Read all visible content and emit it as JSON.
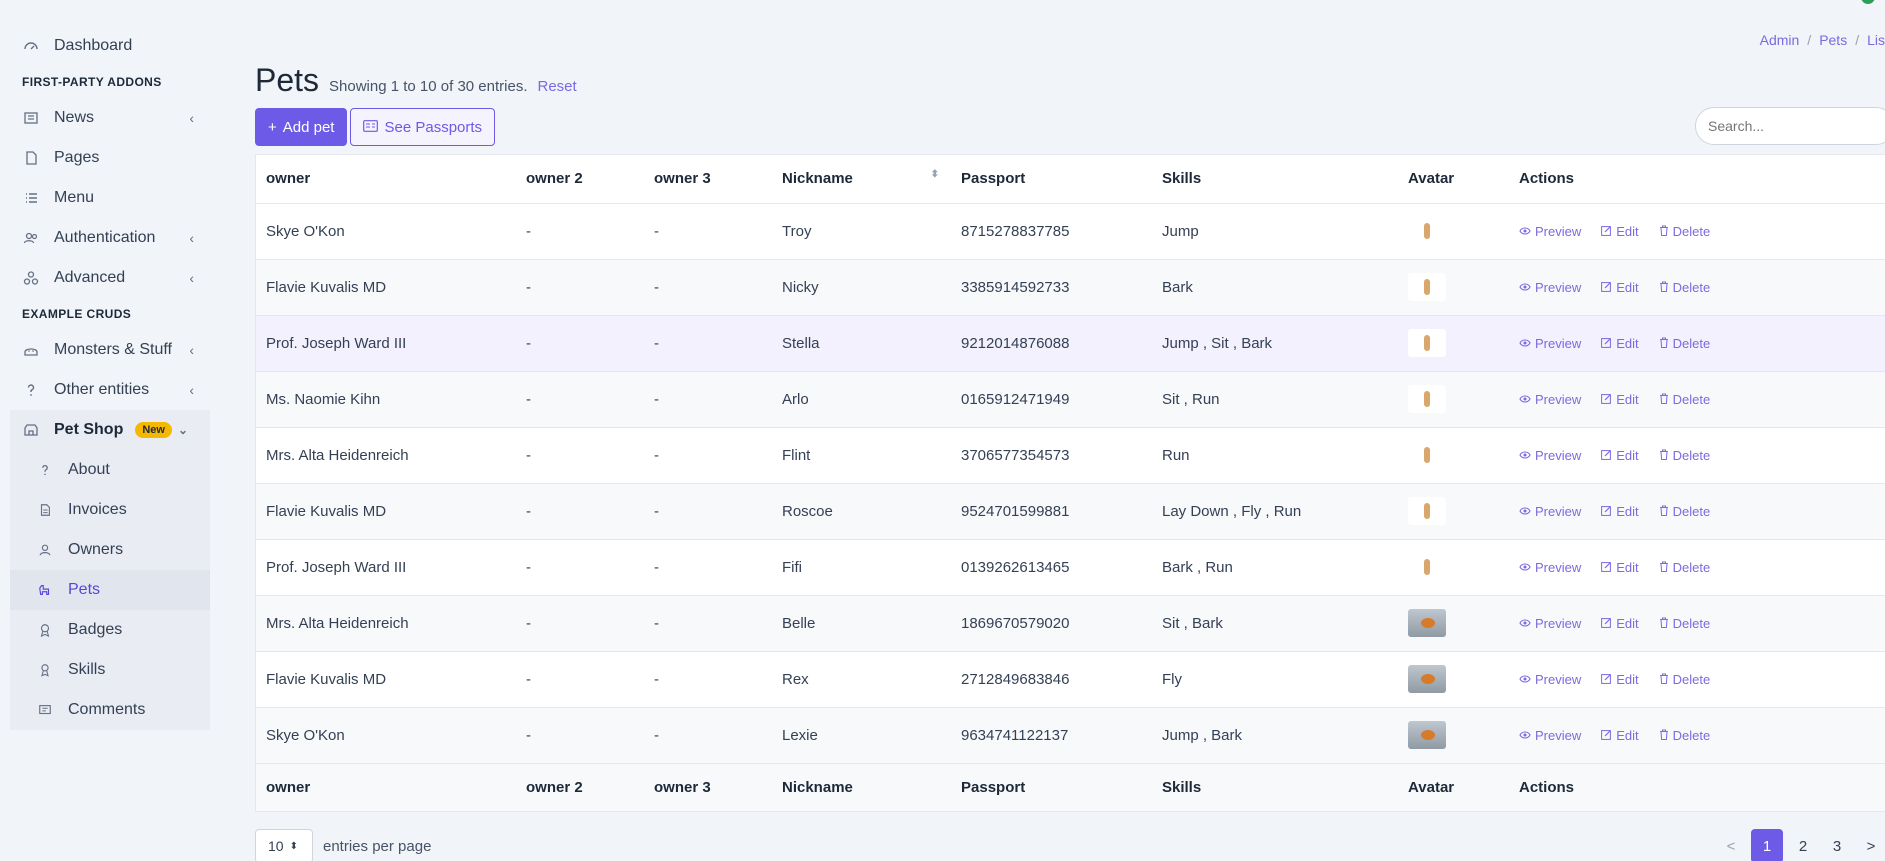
{
  "sidebar": {
    "dashboard": "Dashboard",
    "heading_addons": "FIRST-PARTY ADDONS",
    "news": "News",
    "pages": "Pages",
    "menu": "Menu",
    "authentication": "Authentication",
    "advanced": "Advanced",
    "heading_cruds": "EXAMPLE CRUDS",
    "monsters": "Monsters & Stuff",
    "other_entities": "Other entities",
    "pet_shop": "Pet Shop",
    "pet_shop_badge": "New",
    "sub_items": [
      "About",
      "Invoices",
      "Owners",
      "Pets",
      "Badges",
      "Skills",
      "Comments"
    ],
    "chevron": "‹"
  },
  "breadcrumb": [
    "Admin",
    "Pets",
    "Lis"
  ],
  "header": {
    "title": "Pets",
    "subtitle": "Showing 1 to 10 of 30 entries.",
    "reset": "Reset"
  },
  "buttons": {
    "add": "Add pet",
    "passports": "See Passports"
  },
  "search": {
    "placeholder": "Search..."
  },
  "table": {
    "columns": [
      "owner",
      "owner 2",
      "owner 3",
      "Nickname",
      "Passport",
      "Skills",
      "Avatar",
      "Actions"
    ],
    "rows": [
      {
        "owner": "Skye O'Kon",
        "owner2": "-",
        "owner3": "-",
        "nickname": "Troy",
        "passport": "8715278837785",
        "skills": "Jump",
        "avatar": "rabbit"
      },
      {
        "owner": "Flavie Kuvalis MD",
        "owner2": "-",
        "owner3": "-",
        "nickname": "Nicky",
        "passport": "3385914592733",
        "skills": "Bark",
        "avatar": "rabbit"
      },
      {
        "owner": "Prof. Joseph Ward III",
        "owner2": "-",
        "owner3": "-",
        "nickname": "Stella",
        "passport": "9212014876088",
        "skills": "Jump , Sit , Bark",
        "avatar": "rabbit"
      },
      {
        "owner": "Ms. Naomie Kihn",
        "owner2": "-",
        "owner3": "-",
        "nickname": "Arlo",
        "passport": "0165912471949",
        "skills": "Sit , Run",
        "avatar": "rabbit"
      },
      {
        "owner": "Mrs. Alta Heidenreich",
        "owner2": "-",
        "owner3": "-",
        "nickname": "Flint",
        "passport": "3706577354573",
        "skills": "Run",
        "avatar": "rabbit"
      },
      {
        "owner": "Flavie Kuvalis MD",
        "owner2": "-",
        "owner3": "-",
        "nickname": "Roscoe",
        "passport": "9524701599881",
        "skills": "Lay Down , Fly , Run",
        "avatar": "rabbit"
      },
      {
        "owner": "Prof. Joseph Ward III",
        "owner2": "-",
        "owner3": "-",
        "nickname": "Fifi",
        "passport": "0139262613465",
        "skills": "Bark , Run",
        "avatar": "rabbit"
      },
      {
        "owner": "Mrs. Alta Heidenreich",
        "owner2": "-",
        "owner3": "-",
        "nickname": "Belle",
        "passport": "1869670579020",
        "skills": "Sit , Bark",
        "avatar": "bird"
      },
      {
        "owner": "Flavie Kuvalis MD",
        "owner2": "-",
        "owner3": "-",
        "nickname": "Rex",
        "passport": "2712849683846",
        "skills": "Fly",
        "avatar": "bird"
      },
      {
        "owner": "Skye O'Kon",
        "owner2": "-",
        "owner3": "-",
        "nickname": "Lexie",
        "passport": "9634741122137",
        "skills": "Jump , Bark",
        "avatar": "bird"
      }
    ],
    "actions": {
      "preview": "Preview",
      "edit": "Edit",
      "delete": "Delete"
    }
  },
  "footer": {
    "per_page_value": "10",
    "per_page_label": "entries per page",
    "pages": [
      "<",
      "1",
      "2",
      "3",
      ">"
    ],
    "current_page": "1"
  }
}
